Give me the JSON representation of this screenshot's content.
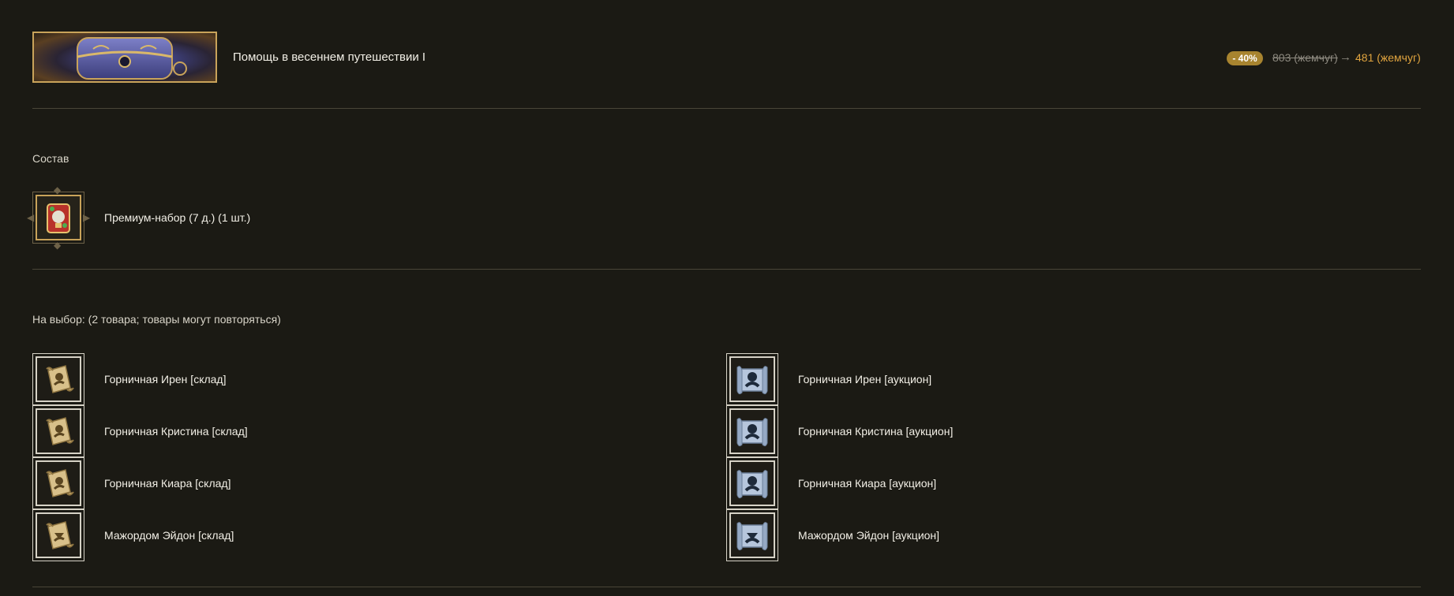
{
  "header": {
    "title": "Помощь в весеннем путешествии I",
    "discount_badge": "- 40%",
    "old_price": "803 (жемчуг)",
    "arrow": "→",
    "new_price": "481 (жемчуг)"
  },
  "composition": {
    "label": "Состав",
    "items": [
      {
        "label": "Премиум-набор (7 д.) (1 шт.)",
        "icon": "premium-pack-icon"
      }
    ]
  },
  "choice": {
    "label": "На выбор: (2 товара; товары могут повторяться)",
    "left_items": [
      {
        "label": "Горничная Ирен [склад]",
        "icon": "scroll-icon"
      },
      {
        "label": "Горничная Кристина [склад]",
        "icon": "scroll-icon"
      },
      {
        "label": "Горничная Киара [склад]",
        "icon": "scroll-icon"
      },
      {
        "label": "Мажордом Эйдон [склад]",
        "icon": "scroll-icon"
      }
    ],
    "right_items": [
      {
        "label": "Горничная Ирен [аукцион]",
        "icon": "blue-scroll-icon"
      },
      {
        "label": "Горничная Кристина [аукцион]",
        "icon": "blue-scroll-icon"
      },
      {
        "label": "Горничная Киара [аукцион]",
        "icon": "blue-scroll-icon"
      },
      {
        "label": "Мажордом Эйдон [аукцион]",
        "icon": "blue-scroll-icon"
      }
    ]
  },
  "colors": {
    "background": "#1b1a14",
    "accent_gold": "#c9a35a",
    "price_orange": "#e0a43f",
    "badge": "#a8842f"
  }
}
